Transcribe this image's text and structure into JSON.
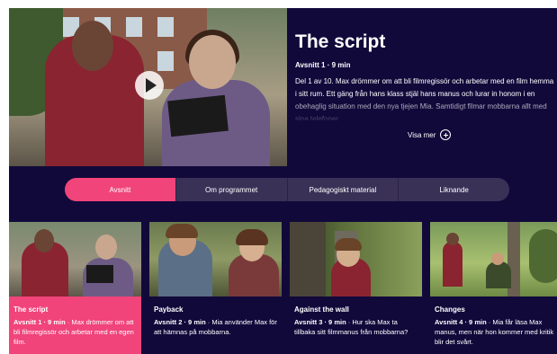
{
  "hero": {
    "title": "The script",
    "meta": "Avsnitt 1 · 9 min",
    "description": "Del 1 av 10. Max drömmer om att bli filmregissör och arbetar med en film hemma i sitt rum. Ett gäng från hans klass stjäl hans manus och lurar in honom i en obehaglig situation med den nya tjejen Mia. Samtidigt filmar mobbarna allt med sina telefoner.",
    "more_label": "Visa mer"
  },
  "tabs": [
    {
      "label": "Avsnitt",
      "active": true
    },
    {
      "label": "Om programmet",
      "active": false
    },
    {
      "label": "Pedagogiskt material",
      "active": false
    },
    {
      "label": "Liknande",
      "active": false
    }
  ],
  "episodes": [
    {
      "title": "The script",
      "meta": "Avsnitt 1 · 9 min",
      "description": " · Max drömmer om att bli filmregissör och arbetar med en egen film.",
      "active": true
    },
    {
      "title": "Payback",
      "meta": "Avsnitt 2 · 9 min",
      "description": " · Mia använder Max för att hämnas på mobbarna.",
      "active": false
    },
    {
      "title": "Against the wall",
      "meta": "Avsnitt 3 · 9 min",
      "description": " · Hur ska Max ta tillbaka sitt filmmanus från mobbarna?",
      "active": false
    },
    {
      "title": "Changes",
      "meta": "Avsnitt 4 · 9 min",
      "description": " · Mia får läsa Max manus, men när hon kommer med kritik blir det svårt.",
      "active": false
    }
  ],
  "colors": {
    "accent": "#f0447a",
    "background": "#12093b",
    "tab_bg": "#3a3157"
  }
}
